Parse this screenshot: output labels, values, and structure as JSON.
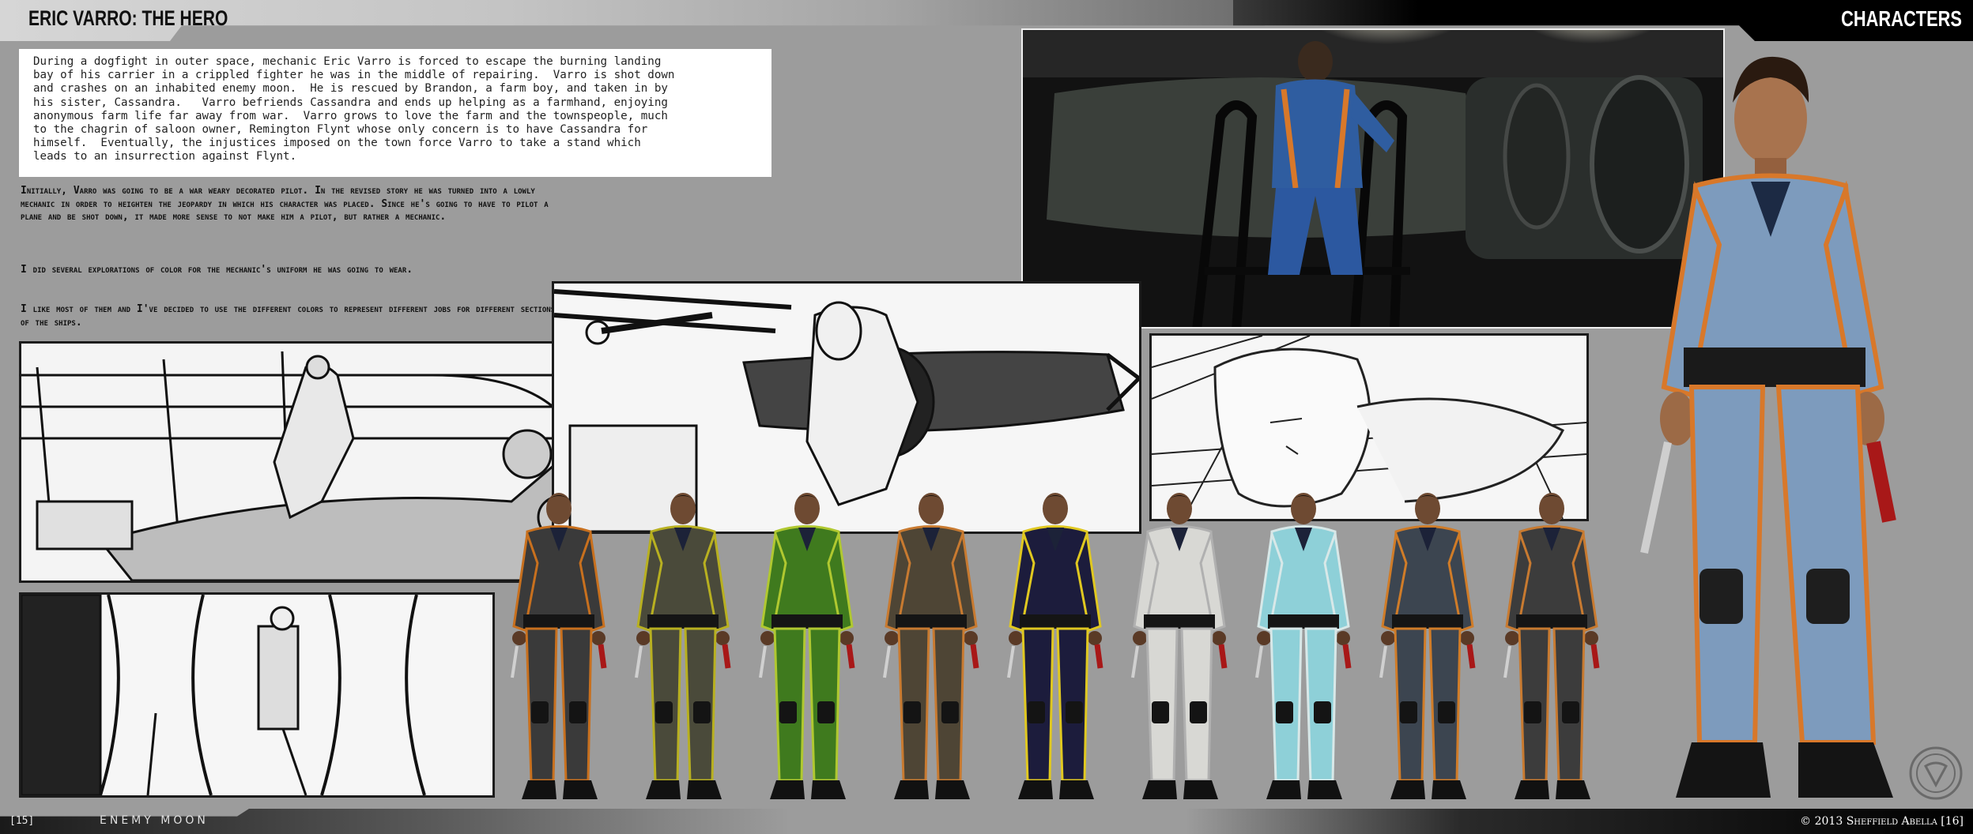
{
  "header": {
    "title": "ERIC VARRO: THE HERO",
    "section": "CHARACTERS"
  },
  "synopsis": "During a dogfight in outer space, mechanic Eric Varro is forced to escape the burning landing\nbay of his carrier in a crippled fighter he was in the middle of repairing.  Varro is shot down\nand crashes on an inhabited enemy moon.  He is rescued by Brandon, a farm boy, and taken in by\nhis sister, Cassandra.   Varro befriends Cassandra and ends up helping as a farmhand, enjoying\nanonymous farm life far away from war.  Varro grows to love the farm and the townspeople, much\nto the chagrin of saloon owner, Remington Flynt whose only concern is to have Cassandra for\nhimself.  Eventually, the injustices imposed on the town force Varro to take a stand which\nleads to an insurrection against Flynt.",
  "notes": [
    "Initially, Varro was going to be a war weary decorated pilot.  In the revised story he was turned into a lowly mechanic in order to heighten the jeopardy in which his character was placed.  Since he's going to have to pilot a plane and be shot down, it made more sense to not make him a pilot, but rather a mechanic.",
    "I did several explorations of color for the mechanic's uniform he was going to wear.",
    "I like most of them and I've decided to use the different colors to represent different jobs for different sections of the ships."
  ],
  "footer": {
    "page_left": "[15]",
    "logo": "ENEMY MOON",
    "copyright": "© 2013 Sheffield Abella [16]"
  },
  "colors": {
    "background": "#9c9c9c",
    "uniform_variants": [
      {
        "suit": "#3a3a3a",
        "trim": "#c8701e"
      },
      {
        "suit": "#4a4a3a",
        "trim": "#b8b020"
      },
      {
        "suit": "#3f7a1e",
        "trim": "#b0c830"
      },
      {
        "suit": "#4e4535",
        "trim": "#c87a30"
      },
      {
        "suit": "#1c1c3c",
        "trim": "#e0c820"
      },
      {
        "suit": "#d8d8d4",
        "trim": "#b0b0b0"
      },
      {
        "suit": "#8ed0d8",
        "trim": "#d8e8e8"
      },
      {
        "suit": "#3c4550",
        "trim": "#d07c28"
      },
      {
        "suit": "#3c3c3c",
        "trim": "#c87a30"
      }
    ],
    "hero_suit": "#7d9bbd",
    "hero_trim": "#d8782a"
  }
}
